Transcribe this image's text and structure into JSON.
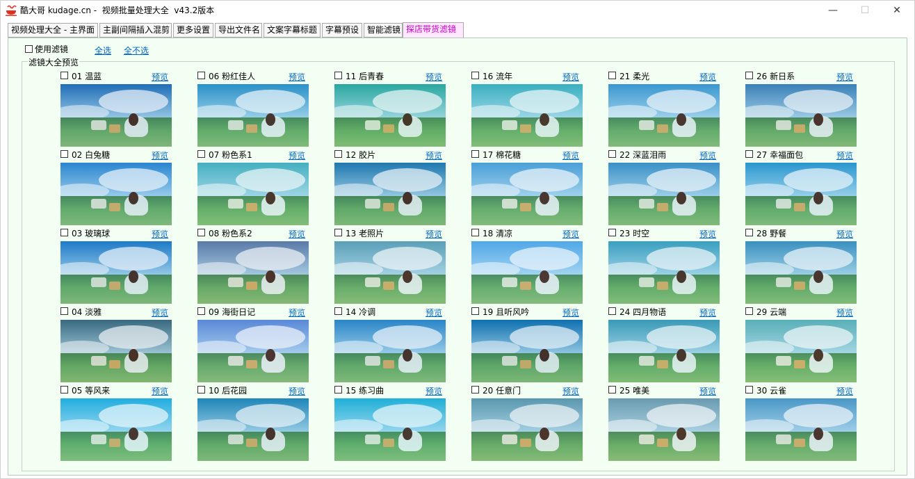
{
  "window": {
    "title": "酷大哥 kudage.cn -  视频批量处理大全  v43.2版本",
    "minimize_glyph": "—",
    "maximize_glyph": "☐",
    "close_glyph": "✕"
  },
  "tabs": [
    {
      "label": "视频处理大全 - 主界面"
    },
    {
      "label": "主副间隔插入混剪"
    },
    {
      "label": "更多设置"
    },
    {
      "label": "导出文件名"
    },
    {
      "label": "文案字幕标题"
    },
    {
      "label": "字幕预设"
    },
    {
      "label": "智能滤镜"
    },
    {
      "label": "探店带货滤镜",
      "active": true
    }
  ],
  "panel": {
    "use_filter_label": "使用滤镜",
    "select_all": "全选",
    "select_none": "全不选",
    "group_title": "滤镜大全预览",
    "preview_label": "预览"
  },
  "filters": [
    {
      "name": "01 温蓝",
      "tint": "#1f6fb8"
    },
    {
      "name": "02 白兔糖",
      "tint": "#2a86d0"
    },
    {
      "name": "03 玻璃球",
      "tint": "#1e7ac8"
    },
    {
      "name": "04 淡雅",
      "tint": "#3a6a80"
    },
    {
      "name": "05 等风来",
      "tint": "#22aee0"
    },
    {
      "name": "06 粉红佳人",
      "tint": "#2a90c8"
    },
    {
      "name": "07 粉色系1",
      "tint": "#45b0c0"
    },
    {
      "name": "08 粉色系2",
      "tint": "#5a7aa8"
    },
    {
      "name": "09 海街日记",
      "tint": "#5a88d8"
    },
    {
      "name": "10 后花园",
      "tint": "#1f86b8"
    },
    {
      "name": "11 后青春",
      "tint": "#2aa8a0"
    },
    {
      "name": "12 胶片",
      "tint": "#1f78b0"
    },
    {
      "name": "13 老照片",
      "tint": "#5aa0b8"
    },
    {
      "name": "14 冷调",
      "tint": "#2a86c8"
    },
    {
      "name": "15 练习曲",
      "tint": "#20b0d8"
    },
    {
      "name": "16 流年",
      "tint": "#3ab0c0"
    },
    {
      "name": "17 棉花糖",
      "tint": "#4aa0d8"
    },
    {
      "name": "18 清凉",
      "tint": "#50a8e8"
    },
    {
      "name": "19 且听风吟",
      "tint": "#1070b0"
    },
    {
      "name": "20 任意门",
      "tint": "#5a98b0"
    },
    {
      "name": "21 柔光",
      "tint": "#3a98d0"
    },
    {
      "name": "22 深蓝泪雨",
      "tint": "#3a90c8"
    },
    {
      "name": "23 时空",
      "tint": "#3aa0c0"
    },
    {
      "name": "24 四月物语",
      "tint": "#3a9ab8"
    },
    {
      "name": "25 唯美",
      "tint": "#6a9ab0"
    },
    {
      "name": "26 新日系",
      "tint": "#3a80b8"
    },
    {
      "name": "27 幸福面包",
      "tint": "#2a98d0"
    },
    {
      "name": "28 野餐",
      "tint": "#3a90c0"
    },
    {
      "name": "29 云端",
      "tint": "#58b0b8"
    },
    {
      "name": "30 云雀",
      "tint": "#4a98c8"
    }
  ]
}
